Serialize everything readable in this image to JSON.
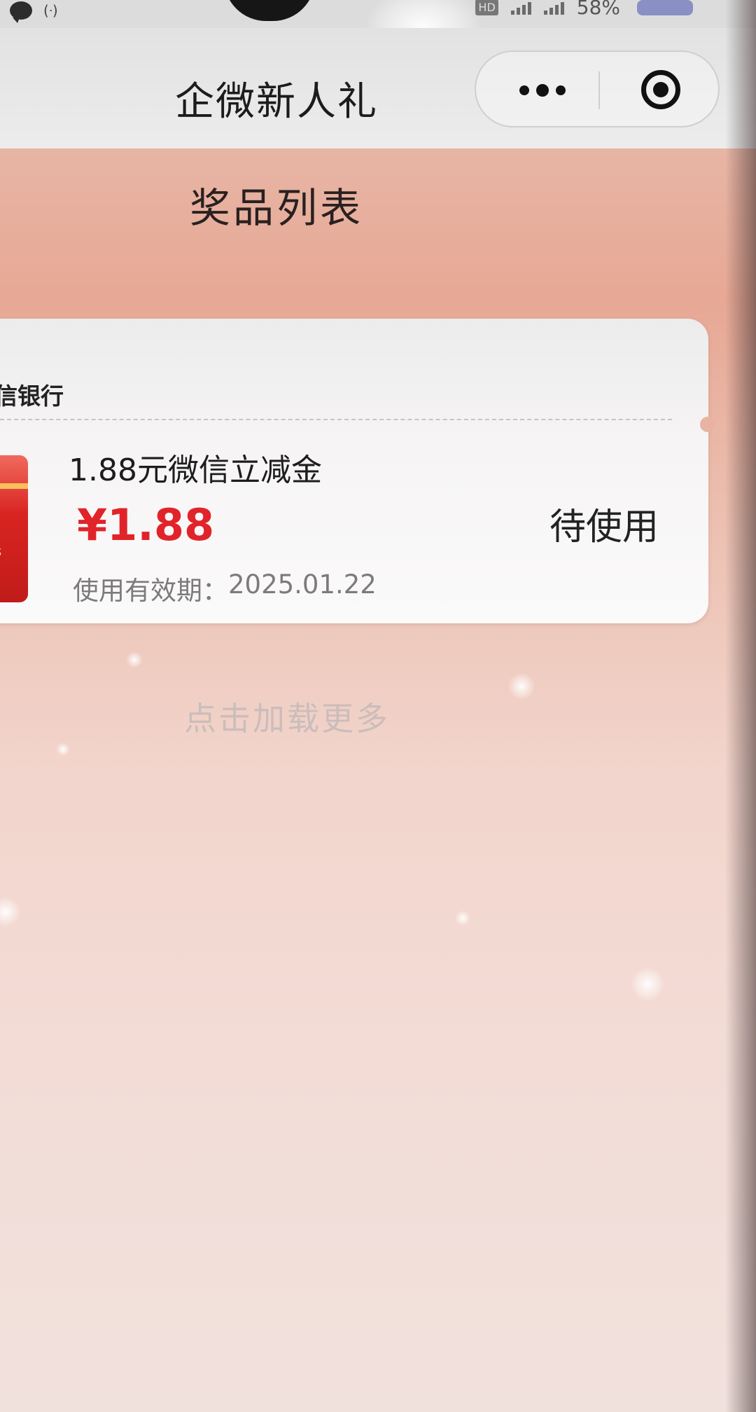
{
  "status_bar": {
    "signal_symbol": "(ᐧ)",
    "hd_label": "HD",
    "battery_text": "58%"
  },
  "nav": {
    "title": "企微新人礼"
  },
  "page": {
    "heading": "奖品列表"
  },
  "prizes": [
    {
      "bank": "信银行",
      "name": "1.88元微信立减金",
      "amount": "¥1.88",
      "validity_label": "使用有效期：",
      "validity_date": "2025.01.22",
      "status": "待使用",
      "thumb_text": "元"
    }
  ],
  "load_more": "点击加载更多",
  "colors": {
    "amount_red": "#e1242a",
    "page_gradient_top": "#e7a895",
    "card_bg": "#f6f4f4"
  }
}
